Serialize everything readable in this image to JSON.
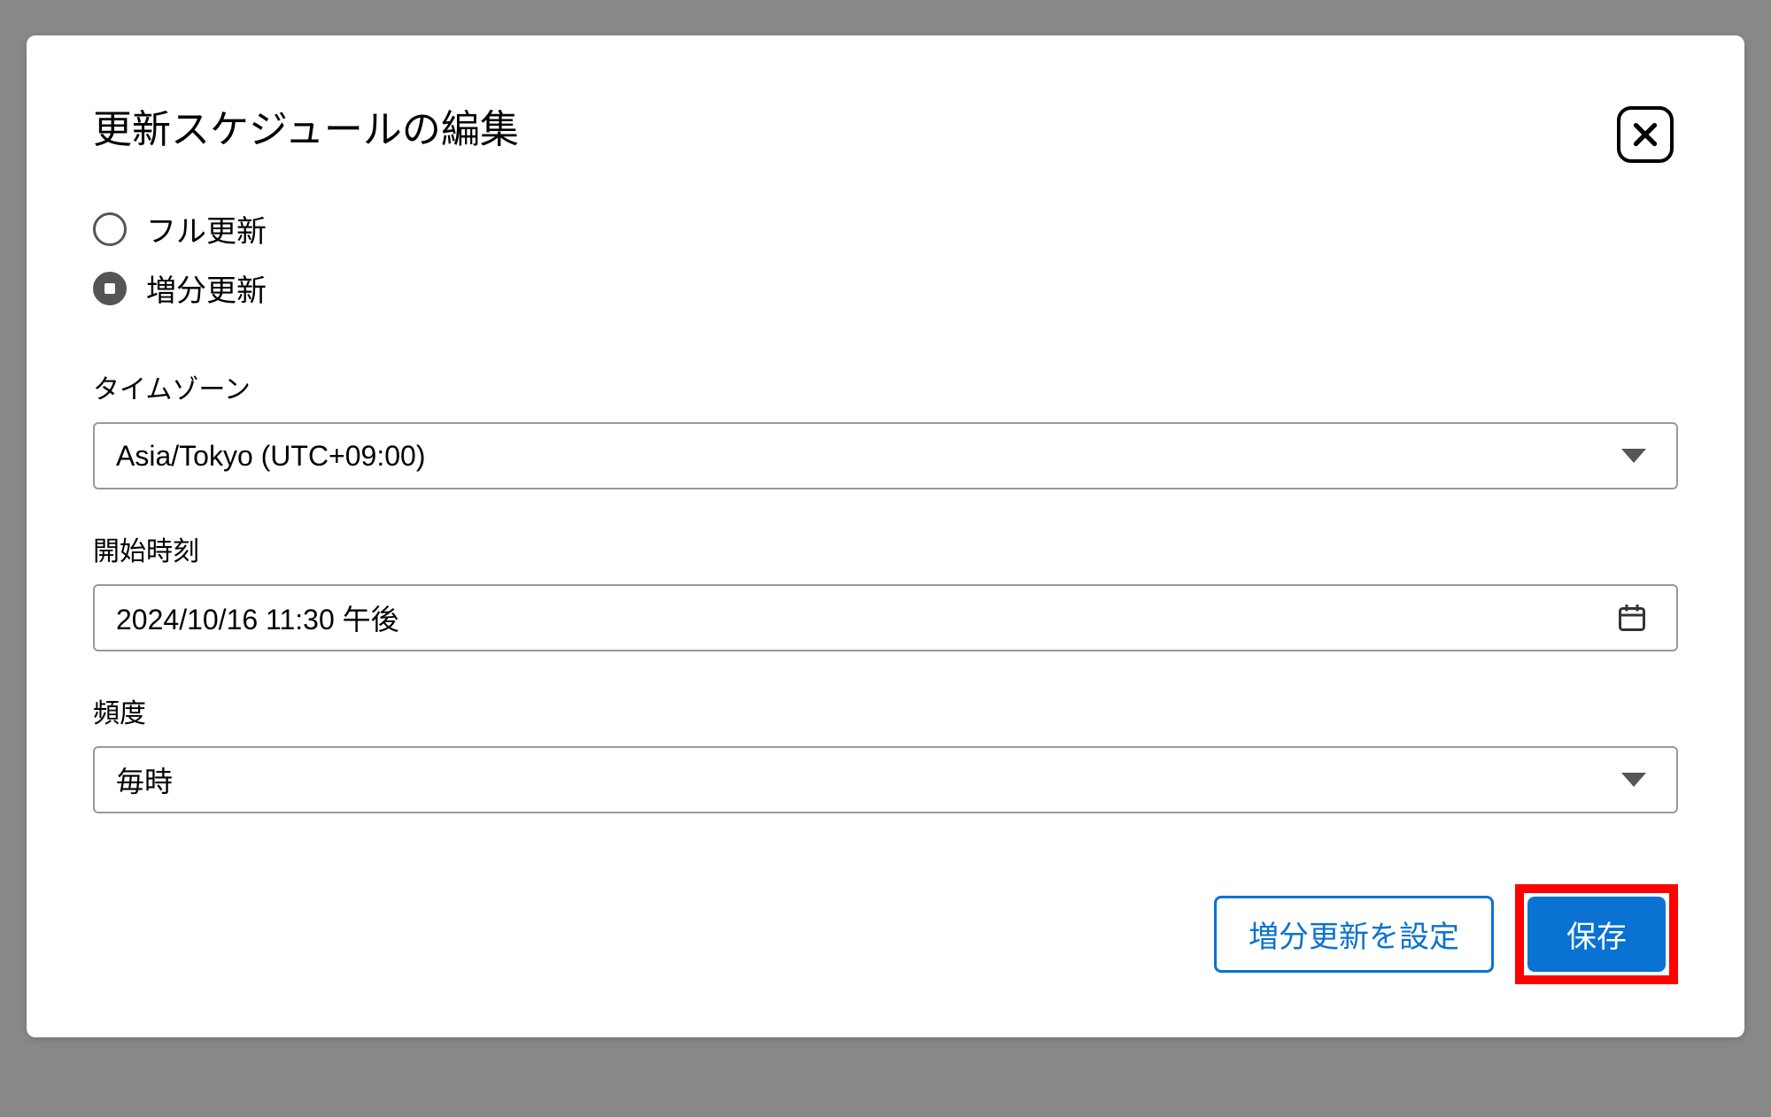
{
  "modal": {
    "title": "更新スケジュールの編集",
    "radio": {
      "full_refresh_label": "フル更新",
      "incremental_refresh_label": "増分更新"
    },
    "timezone": {
      "label": "タイムゾーン",
      "value": "Asia/Tokyo (UTC+09:00)"
    },
    "start_time": {
      "label": "開始時刻",
      "value": "2024/10/16 11:30 午後"
    },
    "frequency": {
      "label": "頻度",
      "value": "毎時"
    },
    "buttons": {
      "configure_incremental": "増分更新を設定",
      "save": "保存"
    }
  }
}
